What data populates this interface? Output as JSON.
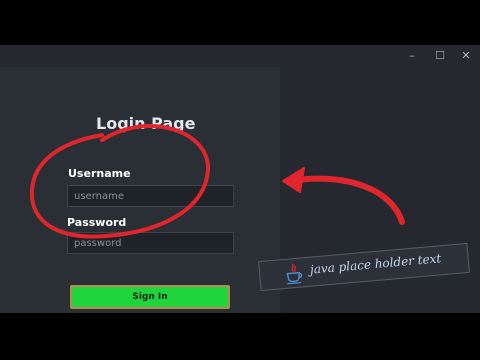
{
  "window": {
    "minimize_glyph": "–",
    "maximize_glyph": "☐",
    "close_glyph": "✕"
  },
  "login": {
    "title": "Login Page",
    "username_label": "Username",
    "username_placeholder": "username",
    "password_label": "Password",
    "password_placeholder": "password",
    "signin_label": "Sign In"
  },
  "annotation": {
    "tooltip_text": "java place holder text",
    "icon": "java-icon",
    "accent_color": "#e0262c",
    "button_color": "#20d53c"
  }
}
